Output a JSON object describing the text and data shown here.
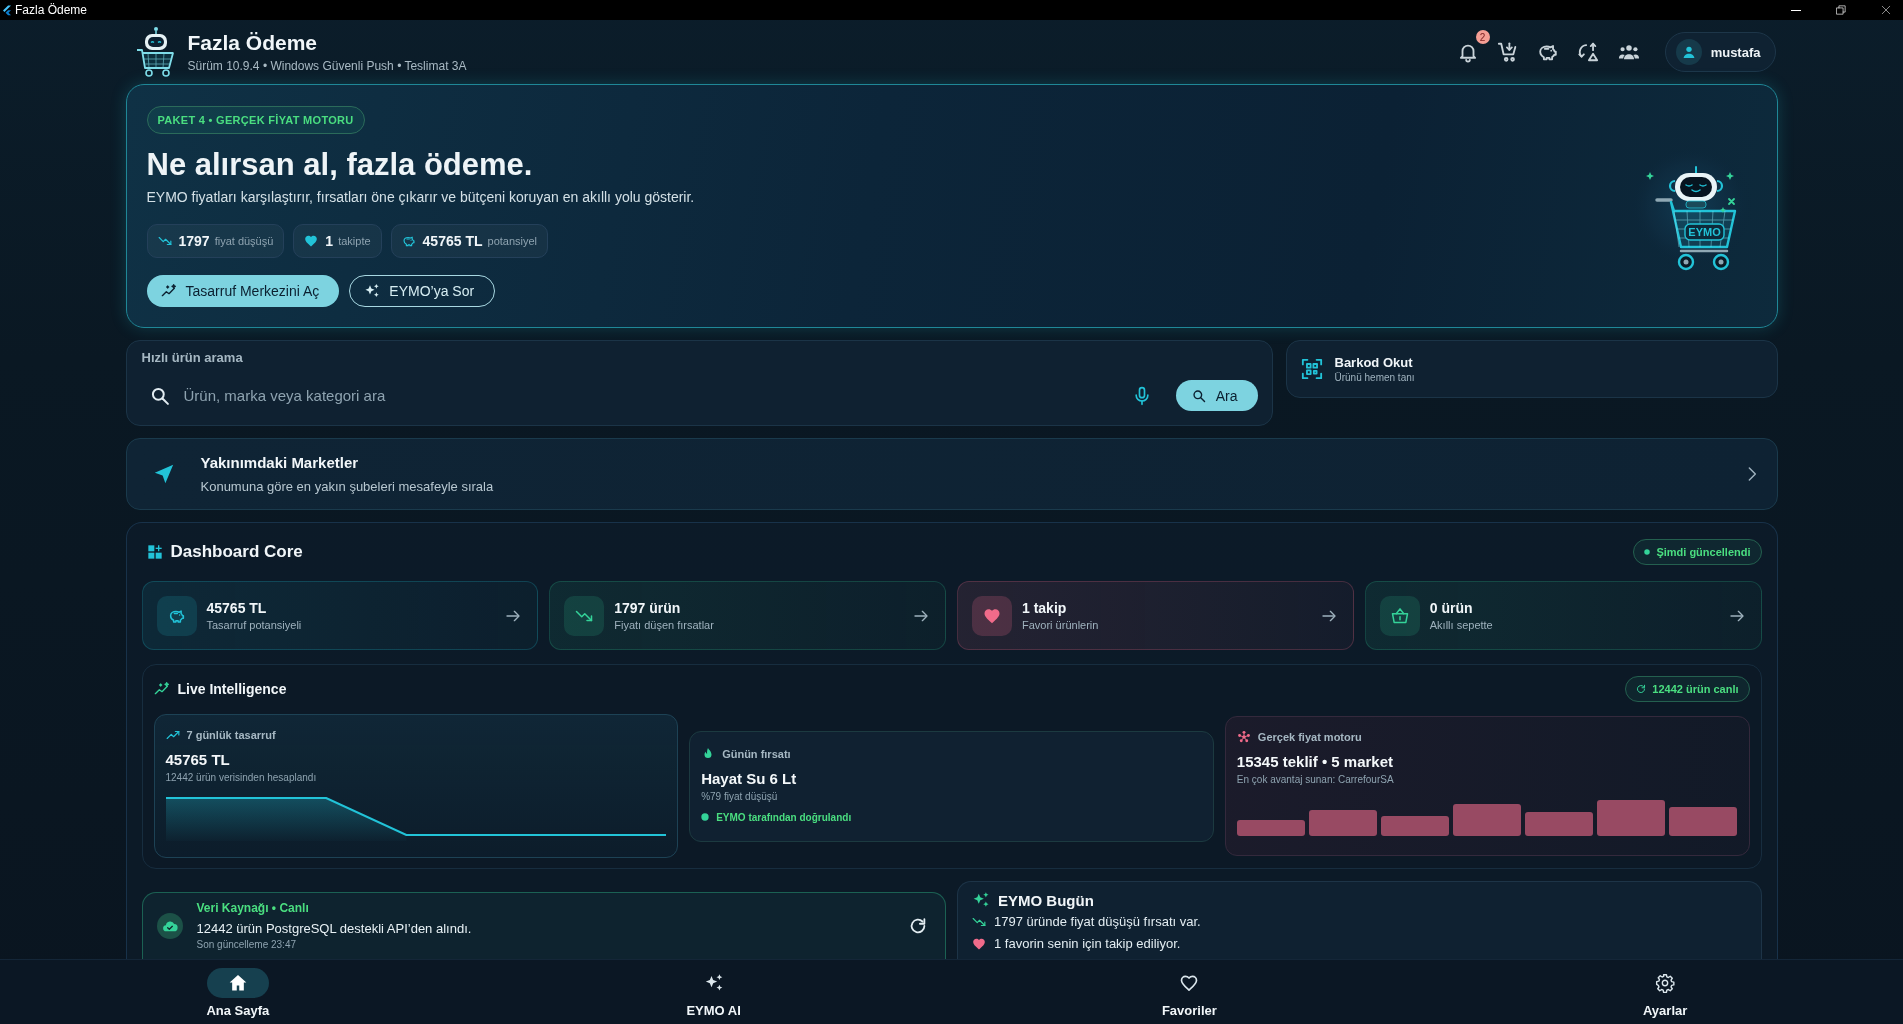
{
  "window": {
    "title": "Fazla Ödeme"
  },
  "header": {
    "title": "Fazla Ödeme",
    "subtitle": "Sürüm 10.9.4 • Windows Güvenli Push • Teslimat 3A",
    "notification_count": "2",
    "user": "mustafa"
  },
  "hero": {
    "badge": "PAKET 4 • GERÇEK FİYAT MOTORU",
    "title": "Ne alırsan al, fazla ödeme.",
    "description": "EYMO fiyatları karşılaştırır, fırsatları öne çıkarır ve bütçeni koruyan en akıllı yolu gösterir.",
    "stats": [
      {
        "kind": "drop",
        "value": "1797",
        "label": "fiyat düşüşü"
      },
      {
        "kind": "favorite",
        "value": "1",
        "label": "takipte"
      },
      {
        "kind": "savings",
        "value": "45765 TL",
        "label": "potansiyel"
      }
    ],
    "buttons": [
      {
        "kind": "primary",
        "label": "Tasarruf Merkezini Aç"
      },
      {
        "kind": "secondary",
        "label": "EYMO’ya Sor"
      }
    ],
    "mascot_label": "EYMO"
  },
  "search": {
    "label": "Hızlı ürün arama",
    "placeholder": "Ürün, marka veya kategori ara",
    "button": "Ara"
  },
  "barcode": {
    "title": "Barkod Okut",
    "subtitle": "Ürünü hemen tanı"
  },
  "nearby": {
    "title": "Yakınımdaki Marketler",
    "subtitle": "Konumuna göre en yakın şubeleri mesafeyle sırala"
  },
  "dashboard": {
    "title": "Dashboard Core",
    "status": "Şimdi güncellendi",
    "cards": [
      {
        "kind": "savings",
        "value": "45765 TL",
        "label": "Tasarruf potansiyeli"
      },
      {
        "kind": "drop",
        "value": "1797 ürün",
        "label": "Fiyatı düşen fırsatlar"
      },
      {
        "kind": "favorite",
        "value": "1 takip",
        "label": "Favori ürünlerin"
      },
      {
        "kind": "basket",
        "value": "0 ürün",
        "label": "Akıllı sepette"
      }
    ]
  },
  "live": {
    "title": "Live Intelligence",
    "status": "12442 ürün canlı",
    "savings": {
      "title": "7 günlük tasarruf",
      "value": "45765 TL",
      "note": "12442 ürün verisinden hesaplandı"
    },
    "deal": {
      "title": "Günün fırsatı",
      "product": "Hayat Su 6 Lt",
      "note": "%79 fiyat düşüşü",
      "verified": "EYMO tarafından doğrulandı"
    },
    "engine": {
      "title": "Gerçek fiyat motoru",
      "value": "15345 teklif • 5 market",
      "note": "En çok avantaj sunan: CarrefourSA"
    }
  },
  "source": {
    "title": "Veri Kaynağı • Canlı",
    "text": "12442 ürün PostgreSQL destekli API’den alındı.",
    "updated": "Son güncelleme 23:47"
  },
  "today": {
    "title": "EYMO Bugün",
    "items": [
      {
        "kind": "drop",
        "text": "1797 üründe fiyat düşüşü fırsatı var."
      },
      {
        "kind": "favorite",
        "text": "1 favorin senin için takip ediliyor."
      }
    ]
  },
  "nav": [
    {
      "kind": "home",
      "label": "Ana Sayfa",
      "selected": true
    },
    {
      "kind": "ai",
      "label": "EYMO AI",
      "selected": false
    },
    {
      "kind": "favorites",
      "label": "Favoriler",
      "selected": false
    },
    {
      "kind": "settings",
      "label": "Ayarlar",
      "selected": false
    }
  ]
}
